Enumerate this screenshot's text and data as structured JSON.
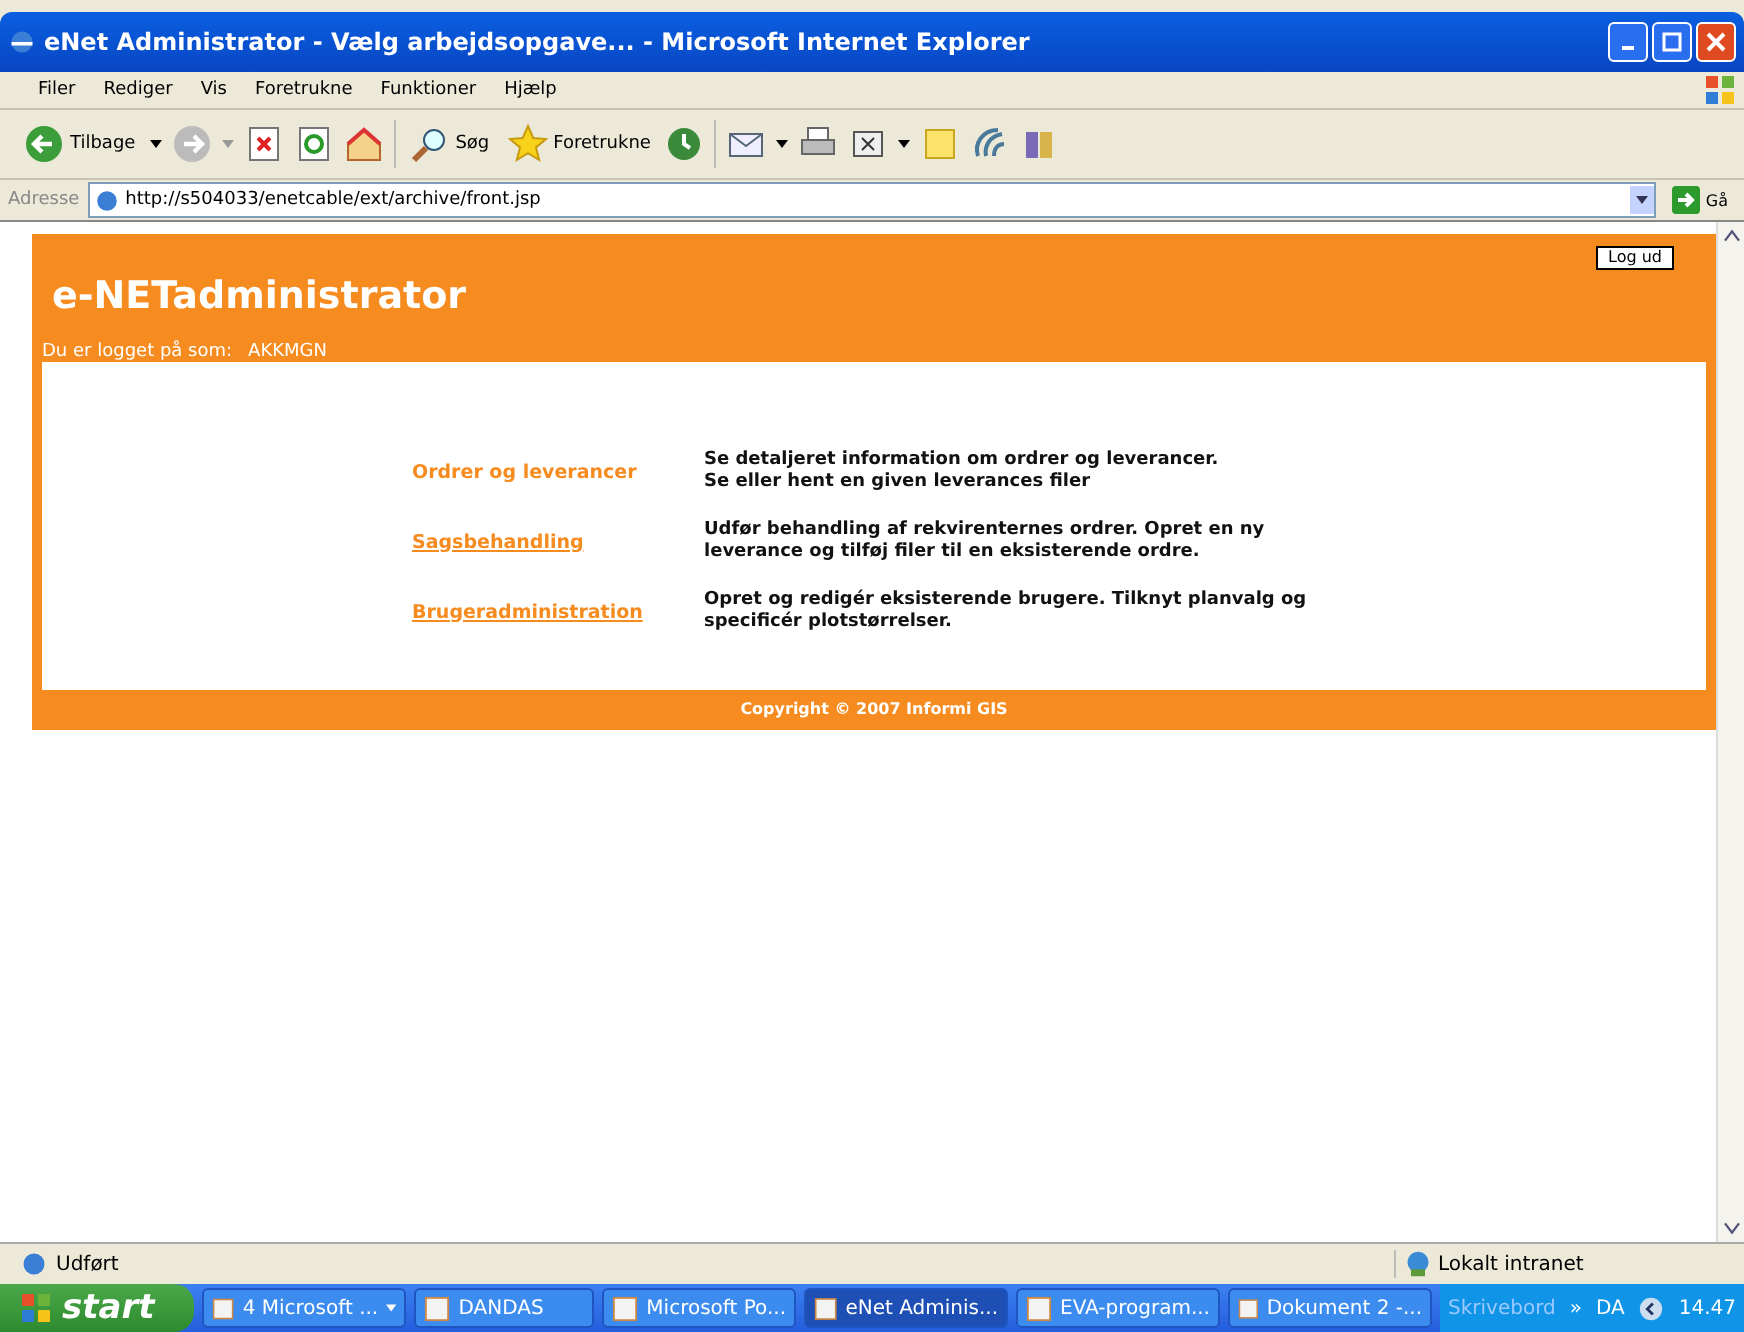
{
  "window": {
    "title": "eNet Administrator - Vælg arbejdsopgave... - Microsoft Internet Explorer"
  },
  "menu": [
    "Filer",
    "Rediger",
    "Vis",
    "Foretrukne",
    "Funktioner",
    "Hjælp"
  ],
  "toolbar": {
    "back": "Tilbage",
    "search": "Søg",
    "favorites": "Foretrukne"
  },
  "address": {
    "label": "Adresse",
    "value": "http://s504033/enetcable/ext/archive/front.jsp",
    "go": "Gå"
  },
  "page": {
    "logout": "Log ud",
    "title": "e-NETadministrator",
    "user_label": "Du er logget på som:",
    "user": "AKKMGN",
    "items": [
      {
        "link": "Ordrer og leverancer",
        "underlined": false,
        "description": "Se detaljeret information om ordrer og leverancer.\nSe eller hent en given leverances filer"
      },
      {
        "link": "Sagsbehandling",
        "underlined": true,
        "description": "Udfør behandling af rekvirenternes ordrer. Opret en ny leverance og tilføj filer til en eksisterende ordre."
      },
      {
        "link": "Brugeradministration",
        "underlined": true,
        "description": "Opret og redigér eksisterende brugere. Tilknyt planvalg og specificér plotstørrelser."
      }
    ],
    "copyright": "Copyright © 2007 Informi GIS"
  },
  "status_bar": {
    "text": "Udført",
    "zone": "Lokalt intranet"
  },
  "taskbar": {
    "start": "start",
    "tasks": [
      {
        "label": "4 Microsoft ...",
        "selected": false,
        "group": true
      },
      {
        "label": "DANDAS",
        "selected": false,
        "group": false
      },
      {
        "label": "Microsoft Po...",
        "selected": false,
        "group": false
      },
      {
        "label": "eNet Adminis...",
        "selected": true,
        "group": false
      },
      {
        "label": "EVA-program...",
        "selected": false,
        "group": false
      },
      {
        "label": "Dokument 2 -...",
        "selected": false,
        "group": false
      }
    ],
    "desktop": "Skrivebord",
    "more": "»",
    "language": "DA",
    "clock": "14.47"
  }
}
